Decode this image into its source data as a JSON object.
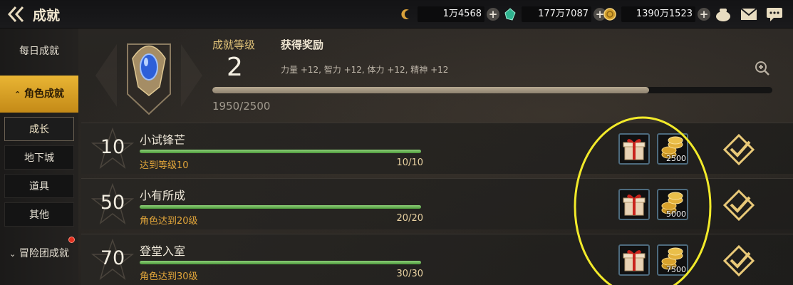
{
  "header": {
    "title": "成就",
    "currencies": [
      {
        "icon": "crescent-coin-icon",
        "value": "1万4568",
        "color": "#d9a13a"
      },
      {
        "icon": "green-gem-icon",
        "value": "177万7087",
        "color": "#2fb38f"
      },
      {
        "icon": "gold-coin-icon",
        "value": "1390万1523",
        "color": "#d3a02c"
      }
    ]
  },
  "sidebar": {
    "items": [
      {
        "label": "每日成就"
      },
      {
        "label": "角色成就",
        "prefix": "⌃"
      },
      {
        "label": "冒险团成就",
        "prefix": "⌄"
      }
    ],
    "subitems": [
      {
        "label": "成长"
      },
      {
        "label": "地下城"
      },
      {
        "label": "道具"
      },
      {
        "label": "其他"
      }
    ]
  },
  "summary": {
    "rank_label": "成就等级",
    "rank_value": "2",
    "reward_label": "获得奖励",
    "reward_text": "力量 +12, 智力 +12, 体力 +12, 精神 +12",
    "exp_text": "1950/2500",
    "exp_fraction": 0.78
  },
  "achievements": [
    {
      "num": "10",
      "title": "小试锋芒",
      "req": "达到等级10",
      "progress": "10/10",
      "fraction": 1.0,
      "gold": "2500"
    },
    {
      "num": "50",
      "title": "小有所成",
      "req": "角色达到20级",
      "progress": "20/20",
      "fraction": 1.0,
      "gold": "5000"
    },
    {
      "num": "70",
      "title": "登堂入室",
      "req": "角色达到30级",
      "progress": "30/30",
      "fraction": 1.0,
      "gold": "7500"
    }
  ],
  "colors": {
    "accent": "#e9b534",
    "progress_green": "#6bbf56",
    "requirement_text": "#e3a63a",
    "annotation_circle": "#f2ea2a"
  }
}
